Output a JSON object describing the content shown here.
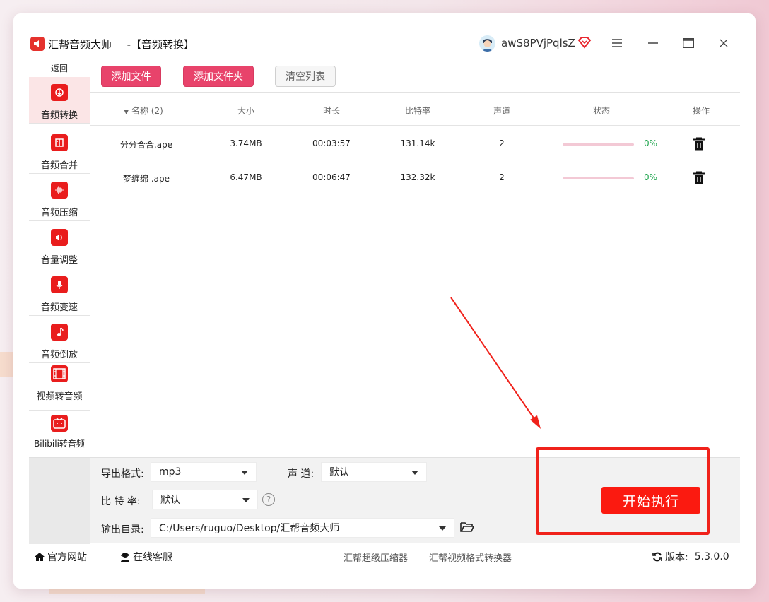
{
  "window": {
    "app_name": "汇帮音频大师",
    "page_title": "-【音频转换】",
    "username": "awS8PVjPqlsZ"
  },
  "sidebar": {
    "back_label": "返回",
    "items": [
      {
        "label": "音频转换",
        "icon": "audio-convert-icon",
        "active": true
      },
      {
        "label": "音频合并",
        "icon": "audio-merge-icon"
      },
      {
        "label": "音频压缩",
        "icon": "audio-compress-icon"
      },
      {
        "label": "音量调整",
        "icon": "volume-adjust-icon"
      },
      {
        "label": "音频变速",
        "icon": "audio-speed-icon"
      },
      {
        "label": "音频倒放",
        "icon": "audio-reverse-icon"
      },
      {
        "label": "视频转音频",
        "icon": "video-to-audio-icon"
      },
      {
        "label": "Bilibili转音频",
        "icon": "bilibili-icon"
      }
    ]
  },
  "toolbar": {
    "add_file": "添加文件",
    "add_folder": "添加文件夹",
    "clear_list": "清空列表"
  },
  "table": {
    "columns": {
      "name": "名称 (2)",
      "size": "大小",
      "duration": "时长",
      "bitrate": "比特率",
      "channels": "声道",
      "status": "状态",
      "action": "操作"
    },
    "rows": [
      {
        "name": "分分合合.ape",
        "size": "3.74MB",
        "duration": "00:03:57",
        "bitrate": "131.14k",
        "channels": "2",
        "progress": 0,
        "progress_text": "0%"
      },
      {
        "name": "梦缠绵 .ape",
        "size": "6.47MB",
        "duration": "00:06:47",
        "bitrate": "132.32k",
        "channels": "2",
        "progress": 0,
        "progress_text": "0%"
      }
    ]
  },
  "settings": {
    "format_label": "导出格式:",
    "format_value": "mp3",
    "channel_label": "声 道:",
    "channel_value": "默认",
    "bitrate_label": "比 特 率:",
    "bitrate_value": "默认",
    "output_label": "输出目录:",
    "output_value": "C:/Users/ruguo/Desktop/汇帮音频大师"
  },
  "start_button": "开始执行",
  "footer": {
    "website": "官方网站",
    "support": "在线客服",
    "compressor": "汇帮超级压缩器",
    "video_converter": "汇帮视频格式转换器",
    "version_label": "版本:",
    "version": "5.3.0.0"
  },
  "colors": {
    "brand_red": "#e91d1d",
    "primary_button": "#e8436b",
    "start_button": "#fb1a10",
    "highlight": "#f0221b",
    "progress_track": "#f3c9d5",
    "percent_text": "#1aa34a"
  }
}
